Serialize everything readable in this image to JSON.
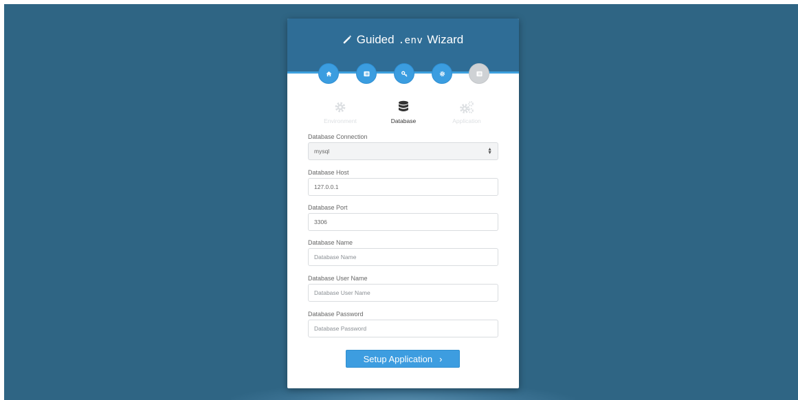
{
  "header": {
    "title_before": "Guided",
    "title_code": ".env",
    "title_after": "Wizard"
  },
  "steps": [
    {
      "icon": "home-icon",
      "state": "done"
    },
    {
      "icon": "list-icon",
      "state": "done"
    },
    {
      "icon": "key-icon",
      "state": "done"
    },
    {
      "icon": "gear-icon",
      "state": "done"
    },
    {
      "icon": "list-icon",
      "state": "pending"
    }
  ],
  "tabs": [
    {
      "label": "Environment",
      "icon": "gear-icon",
      "active": false
    },
    {
      "label": "Database",
      "icon": "database-icon",
      "active": true
    },
    {
      "label": "Application",
      "icon": "gears-icon",
      "active": false
    }
  ],
  "form": {
    "connection": {
      "label": "Database Connection",
      "value": "mysql"
    },
    "host": {
      "label": "Database Host",
      "value": "127.0.0.1"
    },
    "port": {
      "label": "Database Port",
      "value": "3306"
    },
    "name": {
      "label": "Database Name",
      "value": "",
      "placeholder": "Database Name"
    },
    "username": {
      "label": "Database User Name",
      "value": "",
      "placeholder": "Database User Name"
    },
    "password": {
      "label": "Database Password",
      "value": "",
      "placeholder": "Database Password"
    }
  },
  "submit": {
    "label": "Setup Application",
    "chevron": "›"
  },
  "colors": {
    "background": "#2f6584",
    "header": "#2f6d96",
    "accent": "#3d9de0",
    "inactive_step": "#cfd2d5"
  }
}
